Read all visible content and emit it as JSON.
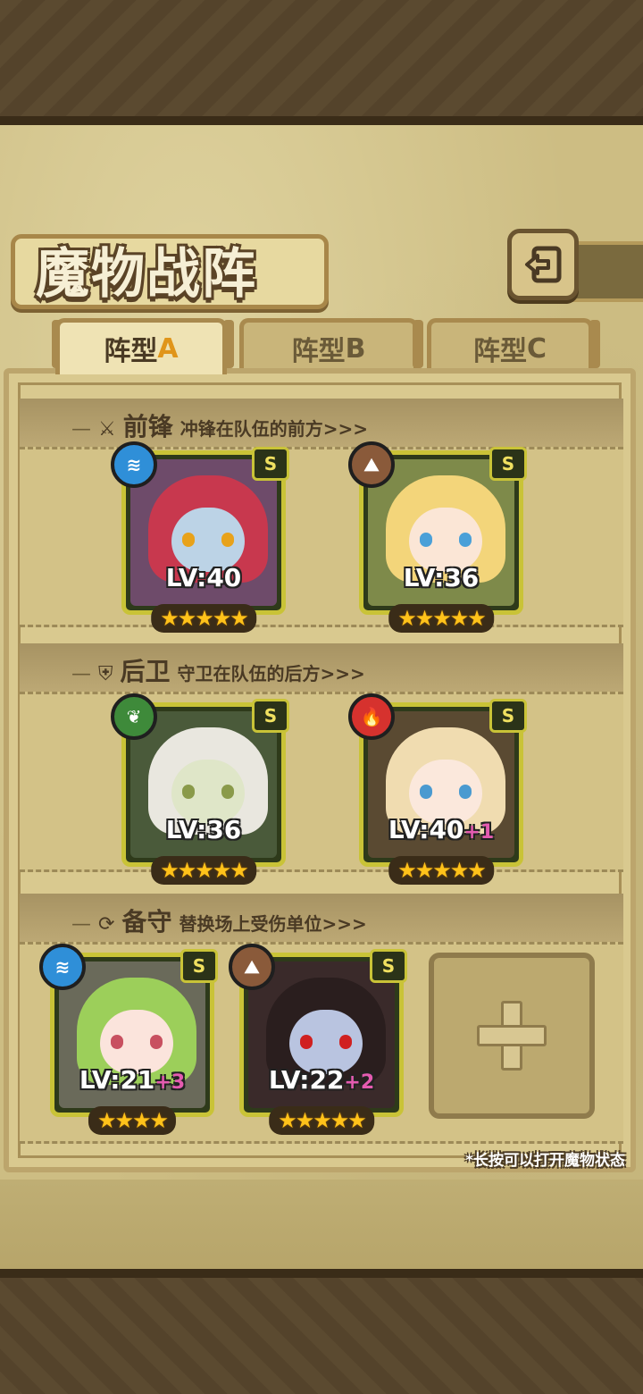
{
  "title": "魔物战阵",
  "tabs": [
    {
      "label": "阵型",
      "suffix": "A",
      "active": true
    },
    {
      "label": "阵型",
      "suffix": "B",
      "active": false
    },
    {
      "label": "阵型",
      "suffix": "C",
      "active": false
    }
  ],
  "sections": [
    {
      "name": "前锋",
      "desc": "冲锋在队伍的前方>>>",
      "icon": "sword-icon"
    },
    {
      "name": "后卫",
      "desc": "守卫在队伍的后方>>>",
      "icon": "shield-icon"
    },
    {
      "name": "备守",
      "desc": "替换场上受伤单位>>>",
      "icon": "swap-icon"
    }
  ],
  "front": [
    {
      "rank": "S",
      "element": "water-icon",
      "element_color": "#2f8fd8",
      "lv": "LV:40",
      "plus": "",
      "stars": "★★★★★",
      "stars_count": 5,
      "hair": "#c8384e",
      "skin": "#bcd3e6",
      "eye": "#e8a21a",
      "bg": "#6e4b6a"
    },
    {
      "rank": "S",
      "element": "earth-icon",
      "element_color": "#8a5a3a",
      "lv": "LV:36",
      "plus": "",
      "stars": "★★★★★",
      "stars_count": 5,
      "hair": "#f3d57a",
      "skin": "#fbe6d6",
      "eye": "#4aa0d8",
      "bg": "#7e8a4a"
    }
  ],
  "rear": [
    {
      "rank": "S",
      "element": "leaf-icon",
      "element_color": "#3e8a3a",
      "lv": "LV:36",
      "plus": "",
      "stars": "★★★★★",
      "stars_count": 5,
      "hair": "#e9e7df",
      "skin": "#dfe6c8",
      "eye": "#8a9a4a",
      "bg": "#4a5a3a"
    },
    {
      "rank": "S",
      "element": "fire-icon",
      "element_color": "#d6322e",
      "lv": "LV:40",
      "plus": "+1",
      "stars": "★★★★★",
      "stars_count": 5,
      "hair": "#f0dcb0",
      "skin": "#fbe8dc",
      "eye": "#4a9ad0",
      "bg": "#5a4a32"
    }
  ],
  "reserve": [
    {
      "rank": "S",
      "element": "water-icon",
      "element_color": "#2f8fd8",
      "lv": "LV:21",
      "plus": "+3",
      "stars": "★★★★",
      "stars_count": 4,
      "hair": "#9ccf5a",
      "skin": "#fbe4dc",
      "eye": "#c85060",
      "bg": "#6a6a5a"
    },
    {
      "rank": "S",
      "element": "earth-icon",
      "element_color": "#8a5a3a",
      "lv": "LV:22",
      "plus": "+2",
      "stars": "★★★★★",
      "stars_count": 5,
      "hair": "#2a1e1e",
      "skin": "#b9c4e0",
      "eye": "#d02020",
      "bg": "#3a2a2a"
    }
  ],
  "empty_slot": {
    "icon": "plus-icon"
  },
  "hint": "*长按可以打开魔物状态"
}
